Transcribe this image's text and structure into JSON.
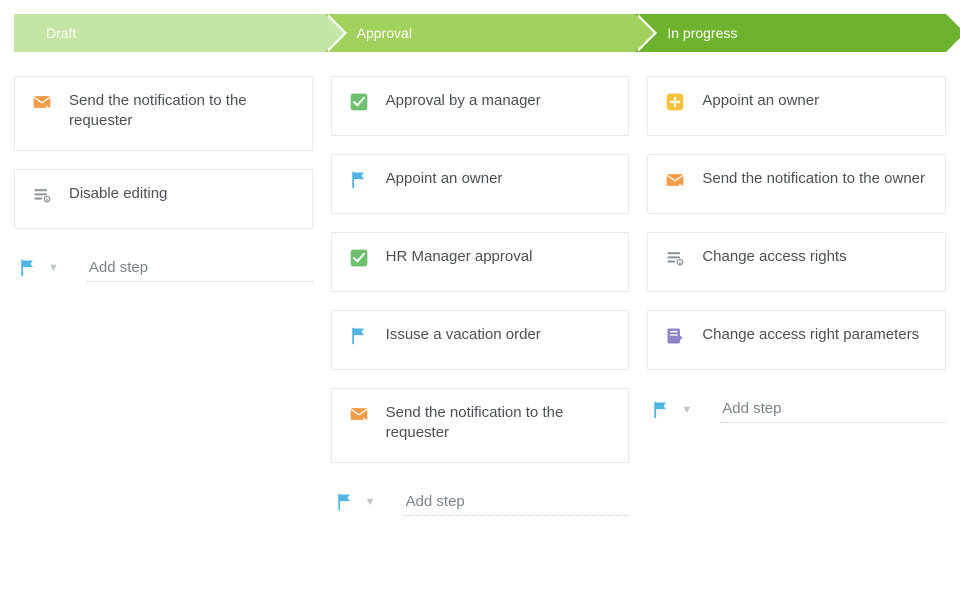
{
  "stages": [
    {
      "id": "draft",
      "label": "Draft"
    },
    {
      "id": "approval",
      "label": "Approval"
    },
    {
      "id": "inprogress",
      "label": "In progress"
    }
  ],
  "columns": {
    "draft": {
      "steps": [
        {
          "icon": "mail",
          "label": "Send the notification to the requester"
        },
        {
          "icon": "lock",
          "label": "Disable editing"
        }
      ],
      "add_placeholder": "Add step"
    },
    "approval": {
      "steps": [
        {
          "icon": "check",
          "label": "Approval by a manager"
        },
        {
          "icon": "flag",
          "label": "Appoint an owner"
        },
        {
          "icon": "check",
          "label": "HR Manager approval"
        },
        {
          "icon": "flag",
          "label": "Issuse a vacation order"
        },
        {
          "icon": "mail",
          "label": "Send the notification to the requester"
        }
      ],
      "add_placeholder": "Add step"
    },
    "inprogress": {
      "steps": [
        {
          "icon": "plus",
          "label": "Appoint an owner"
        },
        {
          "icon": "mail",
          "label": "Send the notification to the owner"
        },
        {
          "icon": "lock",
          "label": "Change access rights"
        },
        {
          "icon": "edit",
          "label": "Change access right parameters"
        }
      ],
      "add_placeholder": "Add step"
    }
  }
}
